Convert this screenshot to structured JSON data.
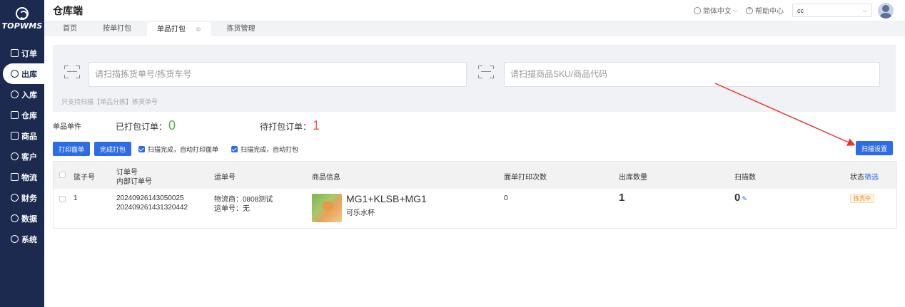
{
  "sidebar": {
    "logo_text": "TOPWMS",
    "items": [
      {
        "label": "订单"
      },
      {
        "label": "出库"
      },
      {
        "label": "入库"
      },
      {
        "label": "仓库"
      },
      {
        "label": "商品"
      },
      {
        "label": "客户"
      },
      {
        "label": "物流"
      },
      {
        "label": "财务"
      },
      {
        "label": "数据"
      },
      {
        "label": "系统"
      }
    ]
  },
  "header": {
    "title": "仓库端",
    "language": "简体中文",
    "help": "帮助中心",
    "user_select_value": "cc"
  },
  "tabs": [
    {
      "label": "首页"
    },
    {
      "label": "按单打包"
    },
    {
      "label": "单品打包"
    },
    {
      "label": "拣货管理"
    }
  ],
  "scan": {
    "pick_placeholder": "请扫描拣货单号/拣货车号",
    "sku_placeholder": "请扫描商品SKU/商品代码",
    "hint": "只支持扫描【单品分拣】拣货单号"
  },
  "stats": {
    "label": "单品单件",
    "packed_label": "已打包订单：",
    "packed_value": "0",
    "pending_label": "待打包订单：",
    "pending_value": "1"
  },
  "toolbar": {
    "print_label": "打印面单",
    "complete_label": "完成打包",
    "auto_print_label": "扫描完成，自动打印面单",
    "auto_pack_label": "扫描完成，自动打包",
    "scan_settings_label": "扫描设置"
  },
  "table": {
    "headers": {
      "basket": "篮子号",
      "order_no": "订单号",
      "inner_order_no": "内部订单号",
      "waybill": "运单号",
      "product": "商品信息",
      "print_count": "面单打印次数",
      "out_qty": "出库数量",
      "scan_count": "扫描数",
      "status": "状态",
      "filter": "筛选"
    },
    "rows": [
      {
        "basket": "1",
        "order_no": "20240926143050025",
        "inner_order_no": "202409261431320442",
        "carrier": "物流商：0808测试",
        "waybill": "运单号：无",
        "product_name": "MG1+KLSB+MG1",
        "product_sub": "可乐水杯",
        "print_count": "0",
        "out_qty": "1",
        "scan_count": "0",
        "status": "拣货中"
      }
    ]
  },
  "colors": {
    "sidebar_bg": "#1b2a4e",
    "primary": "#2e6be6",
    "green": "#4cae4f",
    "red": "#f0595c",
    "annotation_arrow": "#e8332a"
  }
}
